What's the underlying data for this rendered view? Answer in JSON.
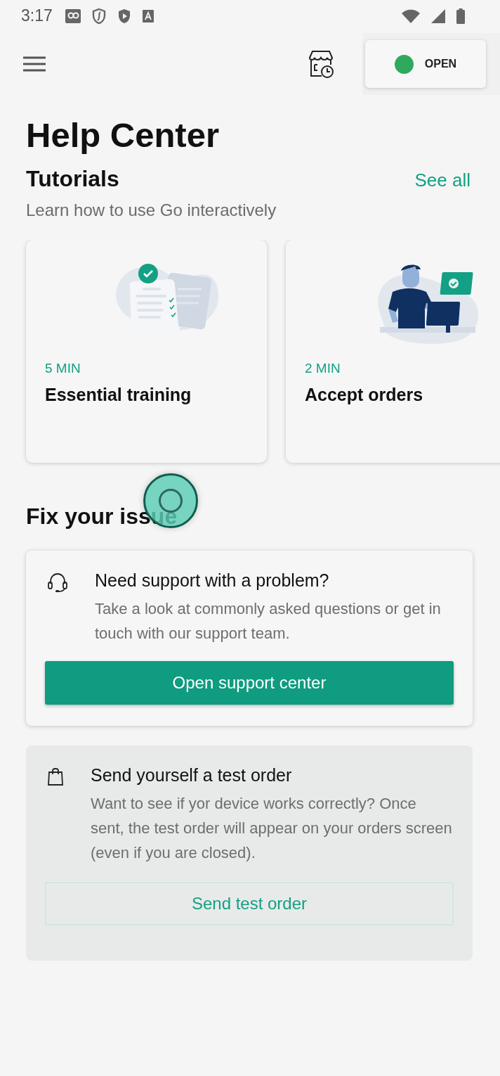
{
  "status_bar": {
    "time": "3:17"
  },
  "top_bar": {
    "store_status": {
      "label": "OPEN",
      "on": true
    }
  },
  "title": "Help Center",
  "tutorials": {
    "heading": "Tutorials",
    "see_all": "See all",
    "subtitle": "Learn how to use Go interactively",
    "cards": [
      {
        "kind": "documents",
        "duration": "5 MIN",
        "title": "Essential training"
      },
      {
        "kind": "person",
        "duration": "2 MIN",
        "title": "Accept orders"
      }
    ]
  },
  "fix_issue": {
    "heading": "Fix your issue",
    "cards": [
      {
        "kind": "raised",
        "title": "Need support with a problem?",
        "text": "Take a look at commonly asked questions or get in touch with our support team.",
        "button": "Open support center"
      },
      {
        "kind": "tinted",
        "title": "Send yourself a test order",
        "text": "Want to see if yor device works correctly? Once sent, the test order will appear on your orders screen (even if you are closed).",
        "button": "Send test order"
      }
    ]
  }
}
